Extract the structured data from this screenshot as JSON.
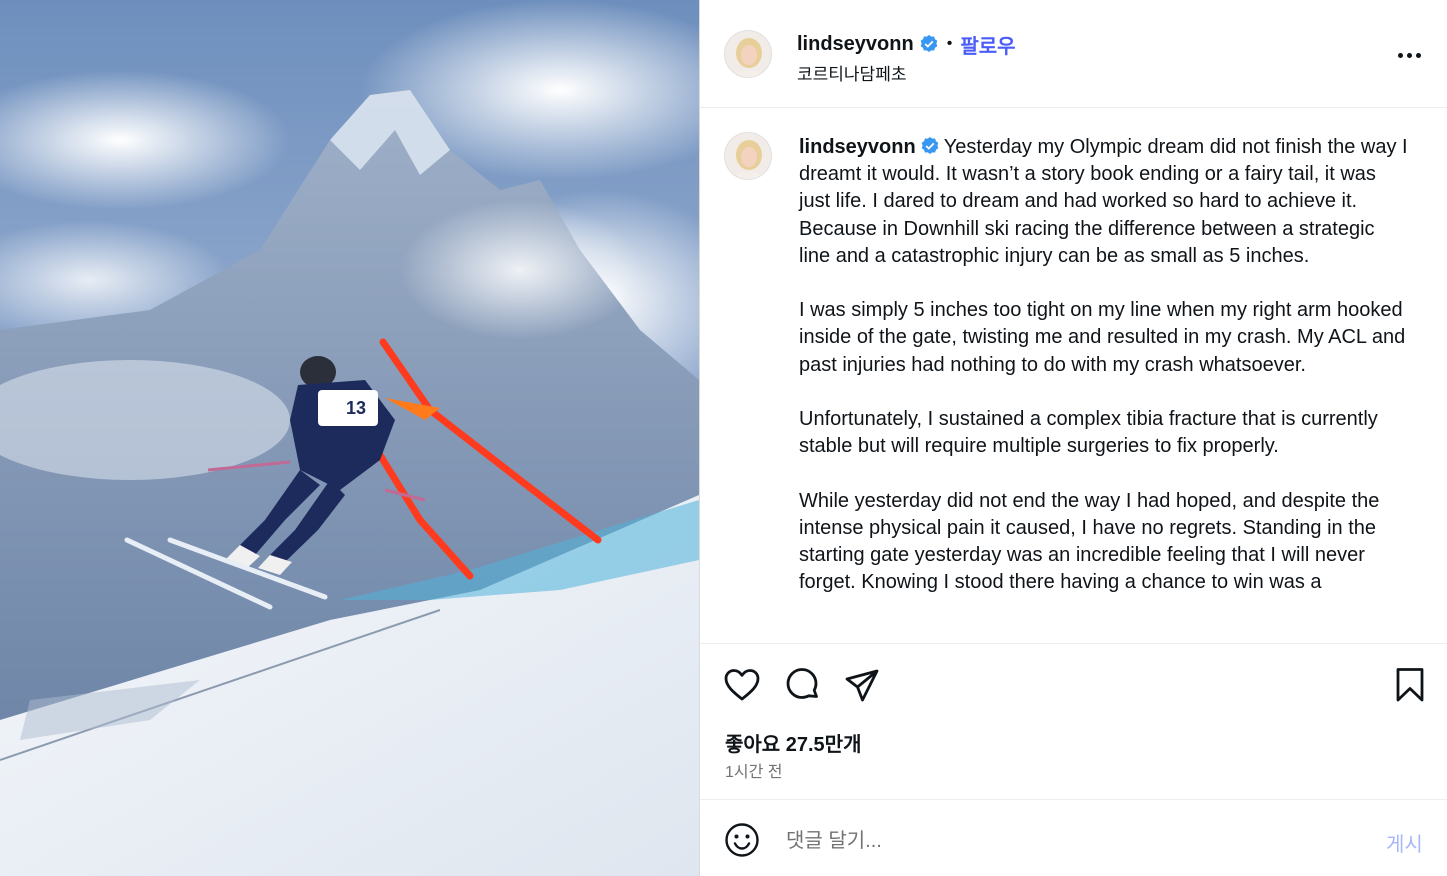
{
  "post": {
    "username": "lindseyvonn",
    "verified": true,
    "follow_label": "팔로우",
    "separator": "•",
    "location": "코르티나담페초",
    "media": {
      "bib_number": "13",
      "colors": {
        "sky": "#7fa0c9",
        "snow": "#eef2f7",
        "gate": "#ff3b1f",
        "suit": "#1d2a5c"
      }
    }
  },
  "caption": {
    "username": "lindseyvonn",
    "paragraphs": [
      "Yesterday my Olympic dream did not finish the way I dreamt it would. It wasn’t a story book ending or a fairy tail, it was just life. I dared to dream and had worked so hard to achieve it. Because in Downhill ski racing the difference between a strategic line and a catastrophic injury can be as small as 5 inches.",
      "I was simply 5 inches too tight on my line when my right arm hooked inside of the gate, twisting me and resulted in my crash. My ACL and past injuries had nothing to do with my crash whatsoever.",
      "Unfortunately, I sustained a complex tibia fracture that is currently stable but will require multiple surgeries to fix properly.",
      "While yesterday did not end the way I had hoped, and despite the intense physical pain it caused, I have no regrets. Standing in the starting gate yesterday was an incredible feeling that I will never forget. Knowing I stood there having a chance to win was a"
    ]
  },
  "actions": {
    "icons": [
      "heart-icon",
      "comment-icon",
      "share-icon",
      "bookmark-icon"
    ],
    "likes_text": "좋아요 27.5만개",
    "time_text": "1시간 전"
  },
  "comment": {
    "placeholder": "댓글 달기...",
    "post_label": "게시",
    "emoji_icon": "smiley-icon"
  },
  "colors": {
    "accent": "#4a5df9",
    "verified": "#3897f0",
    "muted": "#737373",
    "post_disabled": "#a7b7f8"
  }
}
